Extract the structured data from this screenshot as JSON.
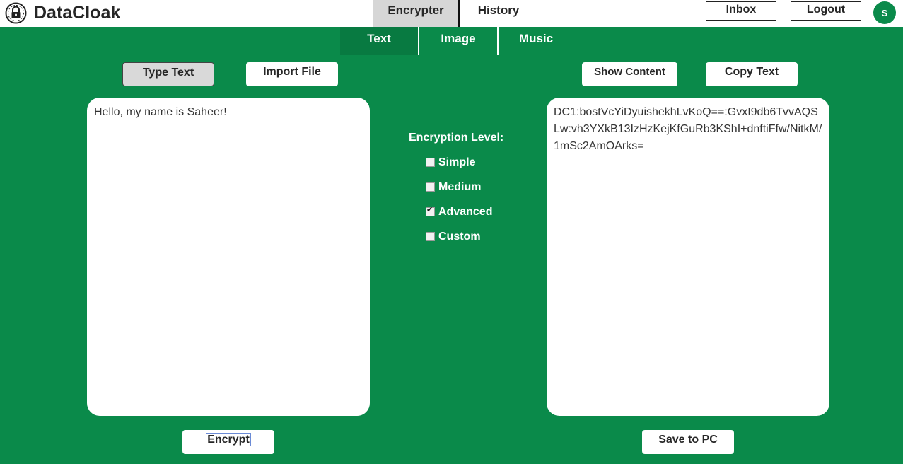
{
  "app": {
    "title": "DataCloak"
  },
  "nav": {
    "encrypter": "Encrypter",
    "history": "History"
  },
  "header": {
    "inbox": "Inbox",
    "logout": "Logout",
    "avatar_initial": "s"
  },
  "subtabs": {
    "text": "Text",
    "image": "Image",
    "music": "Music",
    "active": "Text"
  },
  "left": {
    "type_text": "Type Text",
    "import_file": "Import File",
    "input_value": "Hello, my name is Saheer!",
    "encrypt": "Encrypt"
  },
  "right": {
    "show_content": "Show Content",
    "copy_text": "Copy Text",
    "output_value": "DC1:bostVcYiDyuishekhLvKoQ==:GvxI9db6TvvAQSLw:vh3YXkB13IzHzKejKfGuRb3KShI+dnftiFfw/NitkM/1mSc2AmOArks=",
    "save": "Save to PC"
  },
  "encryption": {
    "label": "Encryption Level:",
    "options": [
      {
        "label": "Simple",
        "checked": false
      },
      {
        "label": "Medium",
        "checked": false
      },
      {
        "label": "Advanced",
        "checked": true
      },
      {
        "label": "Custom",
        "checked": false
      }
    ]
  },
  "colors": {
    "brand_green": "#0a8a4a",
    "active_subtab": "#087a41",
    "active_nav": "#d6d6d6"
  }
}
